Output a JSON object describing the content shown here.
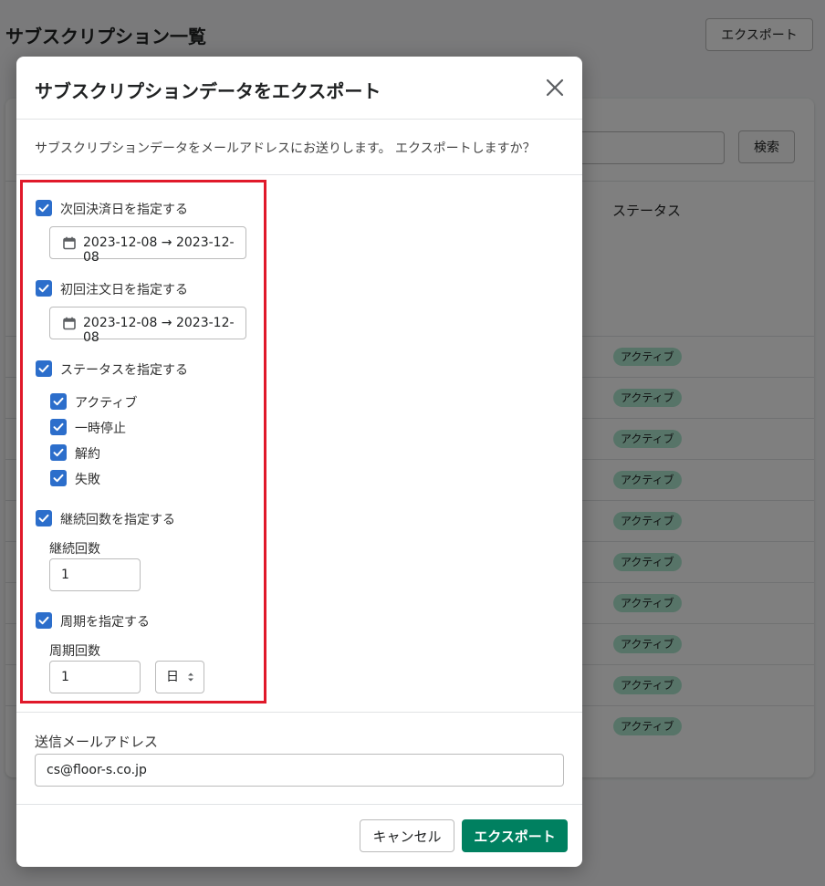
{
  "page": {
    "title": "サブスクリプション一覧",
    "export_button": "エクスポート",
    "search_button": "検索",
    "status_header": "ステータス",
    "row_badges": [
      "アクティブ",
      "アクティブ",
      "アクティブ",
      "アクティブ",
      "アクティブ",
      "アクティブ",
      "アクティブ",
      "アクティブ",
      "アクティブ",
      "アクティブ"
    ]
  },
  "modal": {
    "title": "サブスクリプションデータをエクスポート",
    "description": "サブスクリプションデータをメールアドレスにお送りします。 エクスポートしますか？",
    "next_payment": {
      "label": "次回決済日を指定する",
      "checked": true,
      "range": "2023-12-08 → 2023-12-08"
    },
    "first_order": {
      "label": "初回注文日を指定する",
      "checked": true,
      "range": "2023-12-08 → 2023-12-08"
    },
    "status": {
      "label": "ステータスを指定する",
      "checked": true,
      "options": [
        {
          "label": "アクティブ",
          "checked": true
        },
        {
          "label": "一時停止",
          "checked": true
        },
        {
          "label": "解約",
          "checked": true
        },
        {
          "label": "失敗",
          "checked": true
        }
      ]
    },
    "continuation": {
      "label": "継続回数を指定する",
      "checked": true,
      "field_label": "継続回数",
      "value": "1"
    },
    "cycle": {
      "label": "周期を指定する",
      "checked": true,
      "field_label": "周期回数",
      "value": "1",
      "unit": "日"
    },
    "email": {
      "label": "送信メールアドレス",
      "value": "cs@floor-s.co.jp"
    },
    "cancel_button": "キャンセル",
    "export_button": "エクスポート"
  },
  "colors": {
    "checkbox": "#2c6ecb",
    "primary": "#008060",
    "highlight": "#e0192a",
    "badge": "#aee9d1"
  }
}
